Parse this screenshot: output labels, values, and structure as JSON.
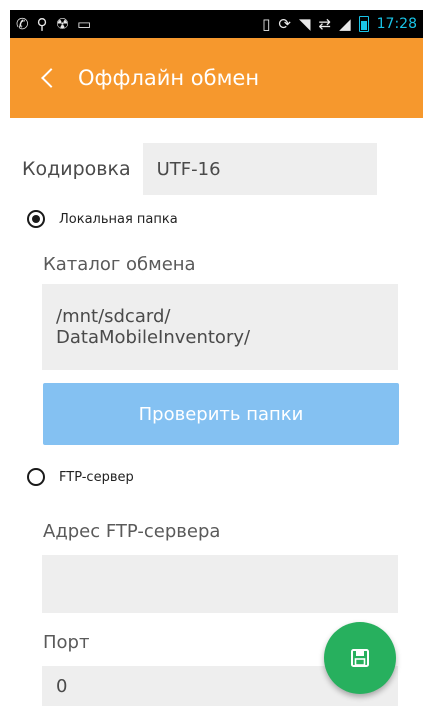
{
  "status_bar": {
    "left_icons": [
      "whatsapp-icon",
      "usb-icon",
      "android-debug-icon",
      "keyboard-icon"
    ],
    "right_icons": [
      "vibrate-icon",
      "sync-icon",
      "wifi-icon",
      "network-sharing-icon",
      "signal-icon",
      "battery-icon"
    ],
    "time": "17:28",
    "accent_color": "#19c3e6"
  },
  "app_bar": {
    "title": "Оффлайн обмен",
    "color": "#f6982d",
    "back_icon": "chevron-left-icon"
  },
  "encoding": {
    "label": "Кодировка",
    "value": "UTF-16"
  },
  "local_folder": {
    "radio_label": "Локальная папка",
    "selected": true,
    "catalog_label": "Каталог обмена",
    "catalog_value_line1": "/mnt/sdcard/",
    "catalog_value_line2": "DataMobileInventory/",
    "check_button": "Проверить папки"
  },
  "ftp": {
    "radio_label": "FTP-сервер",
    "selected": false,
    "address_label": "Адрес FTP-сервера",
    "address_value": "",
    "port_label": "Порт",
    "port_value": "0"
  },
  "fab": {
    "icon": "save-icon",
    "color": "#27b05e"
  }
}
